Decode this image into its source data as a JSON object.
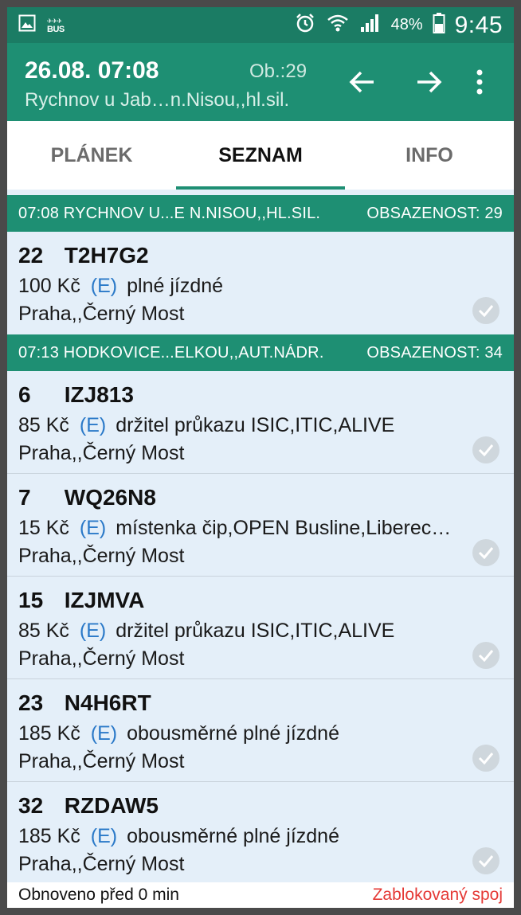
{
  "status_bar": {
    "app_icons": [
      "image-icon",
      "bus-app-icon"
    ],
    "bus_label": "BUS",
    "battery": "48%",
    "time": "9:45"
  },
  "app_bar": {
    "datetime": "26.08. 07:08",
    "occupancy": "Ob.:29",
    "station": "Rychnov u Jab…n.Nisou,,hl.sil."
  },
  "tabs": [
    {
      "label": "PLÁNEK",
      "active": false
    },
    {
      "label": "SEZNAM",
      "active": true
    },
    {
      "label": "INFO",
      "active": false
    }
  ],
  "groups": [
    {
      "route": "07:08 RYCHNOV U...E N.NISOU,,HL.SIL.",
      "occupancy": "OBSAZENOST: 29",
      "tickets": [
        {
          "seat": "22",
          "code": "T2H7G2",
          "price": "100 Kč",
          "e": "(E)",
          "fare": "plné jízdné",
          "destination": "Praha,,Černý Most"
        }
      ]
    },
    {
      "route": "07:13 HODKOVICE...ELKOU,,AUT.NÁDR.",
      "occupancy": "OBSAZENOST: 34",
      "tickets": [
        {
          "seat": "6",
          "code": "IZJ813",
          "price": "85 Kč",
          "e": "(E)",
          "fare": "držitel průkazu ISIC,ITIC,ALIVE",
          "destination": "Praha,,Černý Most"
        },
        {
          "seat": "7",
          "code": "WQ26N8",
          "price": "15 Kč",
          "e": "(E)",
          "fare": "místenka čip,OPEN Busline,Liberec…",
          "destination": "Praha,,Černý Most"
        },
        {
          "seat": "15",
          "code": "IZJMVA",
          "price": "85 Kč",
          "e": "(E)",
          "fare": "držitel průkazu ISIC,ITIC,ALIVE",
          "destination": "Praha,,Černý Most"
        },
        {
          "seat": "23",
          "code": "N4H6RT",
          "price": "185 Kč",
          "e": "(E)",
          "fare": "obousměrné plné jízdné",
          "destination": "Praha,,Černý Most"
        },
        {
          "seat": "32",
          "code": "RZDAW5",
          "price": "185 Kč",
          "e": "(E)",
          "fare": "obousměrné plné jízdné",
          "destination": "Praha,,Černý Most"
        }
      ]
    }
  ],
  "footer": {
    "refresh": "Obnoveno před 0 min",
    "blocked": "Zablokovaný spoj"
  },
  "colors": {
    "primary": "#1e8f73",
    "status_bar": "#1b7c64",
    "list_bg": "#e4eff9",
    "e_badge": "#2a79c8",
    "blocked": "#e53935"
  }
}
